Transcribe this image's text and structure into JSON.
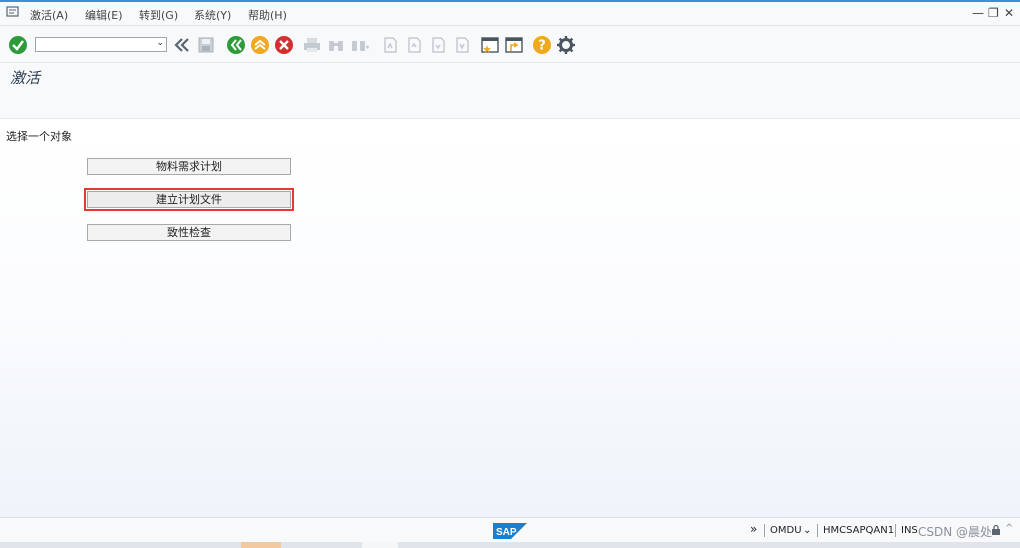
{
  "menu": {
    "items": [
      "激活(A)",
      "编辑(E)",
      "转到(G)",
      "系统(Y)",
      "帮助(H)"
    ]
  },
  "toolbar": {
    "command_field_value": "",
    "icons": [
      "enter-check-icon",
      "command-dropdown",
      "double-left-arrows-icon",
      "save-icon",
      "back-icon",
      "exit-icon",
      "cancel-icon",
      "print-icon",
      "find-icon",
      "find-next-icon",
      "first-page-icon",
      "previous-page-icon",
      "next-page-icon",
      "last-page-icon",
      "create-session-icon",
      "shortcut-icon",
      "help-icon",
      "settings-gear-icon"
    ]
  },
  "title": "激活",
  "content": {
    "prompt": "选择一个对象",
    "buttons": [
      {
        "label": "物料需求计划",
        "selected": false
      },
      {
        "label": "建立计划文件",
        "selected": true
      },
      {
        "label": "致性检查",
        "selected": false
      }
    ]
  },
  "statusbar": {
    "expand": "»",
    "system": "OMDU",
    "server": "HMCSAPQAN1",
    "mode": "INS",
    "watermark": "CSDN @晨处"
  },
  "colors": {
    "accent_blue": "#3d8fd1",
    "ok_green": "#2e9b3a",
    "exit_amber": "#f0a81e",
    "cancel_red": "#d32f2f",
    "selection_red": "#e53935"
  }
}
